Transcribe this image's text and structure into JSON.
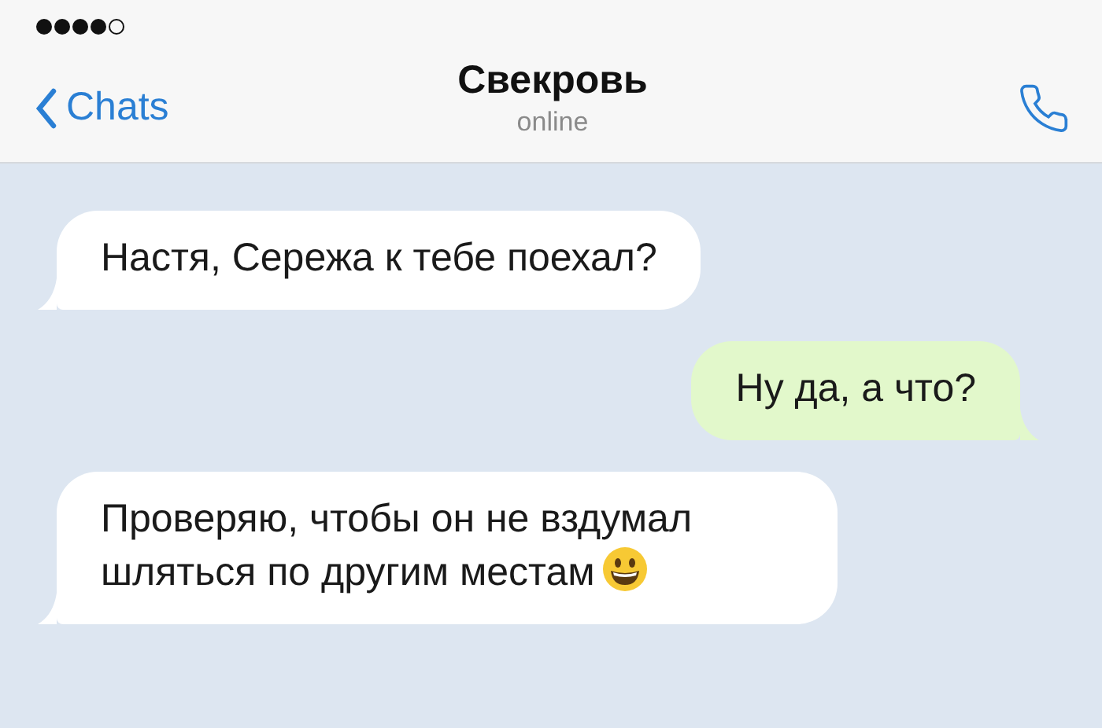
{
  "header": {
    "back_label": "Chats",
    "title": "Свекровь",
    "status": "online"
  },
  "messages": [
    {
      "kind": "incoming",
      "text": "Настя, Сережа к тебе поехал?"
    },
    {
      "kind": "outgoing",
      "text": "Ну да, а что?"
    },
    {
      "kind": "incoming",
      "text": "Проверяю, чтобы он не вздумал шляться по другим местам",
      "emoji": true
    }
  ]
}
